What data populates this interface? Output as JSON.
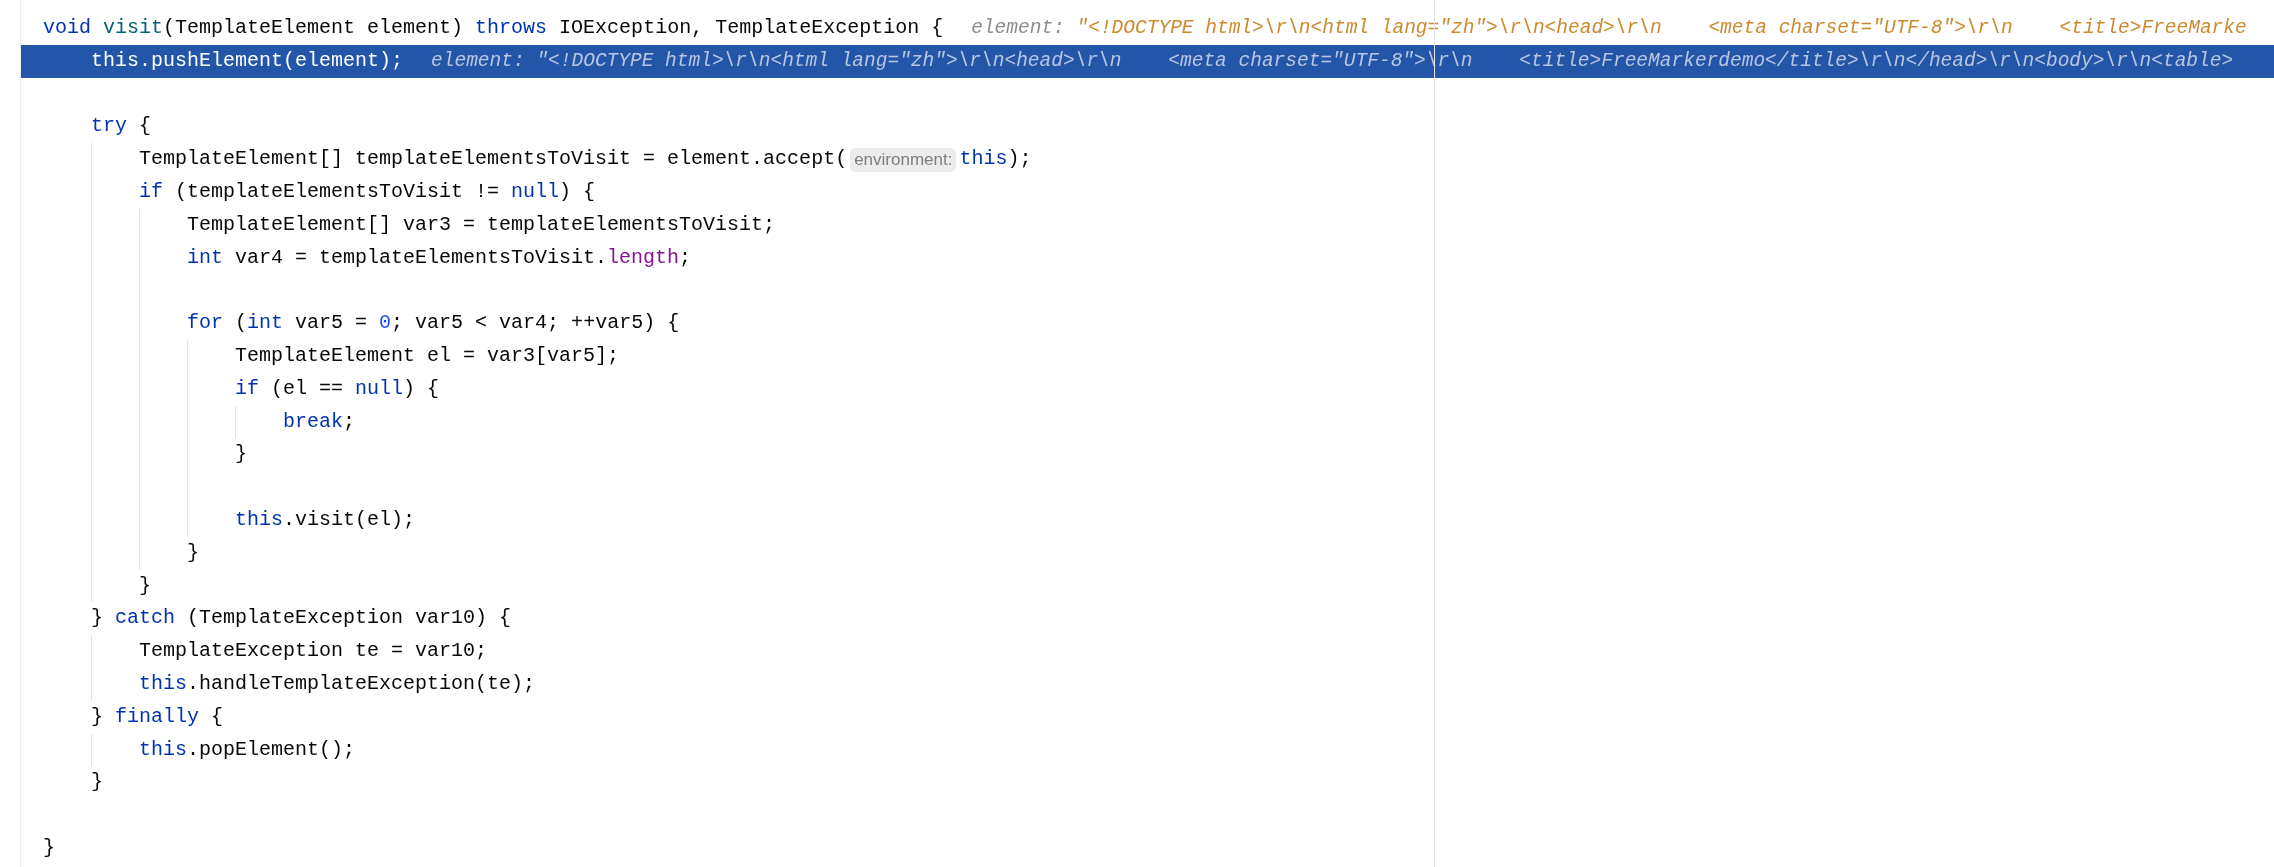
{
  "lines": [
    {
      "kind": "code",
      "selected": false,
      "segments": [
        {
          "kind": "code",
          "tokens": [
            {
              "kind": "keyword",
              "text": "void"
            },
            {
              "kind": "method",
              "text": " visit"
            },
            {
              "kind": "plain",
              "text": "(TemplateElement element) "
            },
            {
              "kind": "keyword",
              "text": "throws"
            },
            {
              "kind": "plain",
              "text": " IOException, TemplateException {"
            }
          ]
        },
        {
          "kind": "value_hint",
          "name": "element:",
          "value": "\"<!DOCTYPE html>\\r\\n<html lang=\"zh\">\\r\\n<head>\\r\\n    <meta charset=\"UTF-8\">\\r\\n    <title>FreeMarke"
        }
      ],
      "children": [
        {
          "kind": "code",
          "selected": true,
          "segments": [
            {
              "kind": "code",
              "tokens": [
                {
                  "kind": "keyword",
                  "text": "this"
                },
                {
                  "kind": "plain",
                  "text": ".pushElement(element);"
                }
              ]
            },
            {
              "kind": "value_hint",
              "name": "element:",
              "value": "\"<!DOCTYPE html>\\r\\n<html lang=\"zh\">\\r\\n<head>\\r\\n    <meta charset=\"UTF-8\">\\r\\n    <title>FreeMarkerdemo</title>\\r\\n</head>\\r\\n<body>\\r\\n<table>"
            }
          ]
        },
        {
          "kind": "blank"
        },
        {
          "kind": "code",
          "selected": false,
          "segments": [
            {
              "kind": "code",
              "tokens": [
                {
                  "kind": "keyword",
                  "text": "try"
                },
                {
                  "kind": "plain",
                  "text": " {"
                }
              ]
            }
          ],
          "children": [
            {
              "kind": "code",
              "selected": false,
              "segments": [
                {
                  "kind": "code",
                  "tokens": [
                    {
                      "kind": "plain",
                      "text": "TemplateElement[] templateElementsToVisit = element.accept("
                    }
                  ]
                },
                {
                  "kind": "param_hint",
                  "text": "environment:"
                },
                {
                  "kind": "code",
                  "tokens": [
                    {
                      "kind": "keyword",
                      "text": "this"
                    },
                    {
                      "kind": "plain",
                      "text": ");"
                    }
                  ]
                }
              ]
            },
            {
              "kind": "code",
              "selected": false,
              "segments": [
                {
                  "kind": "code",
                  "tokens": [
                    {
                      "kind": "keyword",
                      "text": "if"
                    },
                    {
                      "kind": "plain",
                      "text": " (templateElementsToVisit != "
                    },
                    {
                      "kind": "keyword",
                      "text": "null"
                    },
                    {
                      "kind": "plain",
                      "text": ") {"
                    }
                  ]
                }
              ],
              "children": [
                {
                  "kind": "code",
                  "selected": false,
                  "segments": [
                    {
                      "kind": "code",
                      "tokens": [
                        {
                          "kind": "plain",
                          "text": "TemplateElement[] var3 = templateElementsToVisit;"
                        }
                      ]
                    }
                  ]
                },
                {
                  "kind": "code",
                  "selected": false,
                  "segments": [
                    {
                      "kind": "code",
                      "tokens": [
                        {
                          "kind": "keyword",
                          "text": "int"
                        },
                        {
                          "kind": "plain",
                          "text": " var4 = templateElementsToVisit."
                        },
                        {
                          "kind": "field",
                          "text": "length"
                        },
                        {
                          "kind": "plain",
                          "text": ";"
                        }
                      ]
                    }
                  ]
                },
                {
                  "kind": "blank"
                },
                {
                  "kind": "code",
                  "selected": false,
                  "segments": [
                    {
                      "kind": "code",
                      "tokens": [
                        {
                          "kind": "keyword",
                          "text": "for"
                        },
                        {
                          "kind": "plain",
                          "text": " ("
                        },
                        {
                          "kind": "keyword",
                          "text": "int"
                        },
                        {
                          "kind": "plain",
                          "text": " var5 = "
                        },
                        {
                          "kind": "number",
                          "text": "0"
                        },
                        {
                          "kind": "plain",
                          "text": "; var5 < var4; ++var5) {"
                        }
                      ]
                    }
                  ],
                  "children": [
                    {
                      "kind": "code",
                      "selected": false,
                      "segments": [
                        {
                          "kind": "code",
                          "tokens": [
                            {
                              "kind": "plain",
                              "text": "TemplateElement el = var3[var5];"
                            }
                          ]
                        }
                      ]
                    },
                    {
                      "kind": "code",
                      "selected": false,
                      "segments": [
                        {
                          "kind": "code",
                          "tokens": [
                            {
                              "kind": "keyword",
                              "text": "if"
                            },
                            {
                              "kind": "plain",
                              "text": " (el == "
                            },
                            {
                              "kind": "keyword",
                              "text": "null"
                            },
                            {
                              "kind": "plain",
                              "text": ") {"
                            }
                          ]
                        }
                      ],
                      "children": [
                        {
                          "kind": "code",
                          "selected": false,
                          "segments": [
                            {
                              "kind": "code",
                              "tokens": [
                                {
                                  "kind": "keyword",
                                  "text": "break"
                                },
                                {
                                  "kind": "plain",
                                  "text": ";"
                                }
                              ]
                            }
                          ]
                        }
                      ]
                    },
                    {
                      "kind": "code",
                      "selected": false,
                      "segments": [
                        {
                          "kind": "code",
                          "tokens": [
                            {
                              "kind": "plain",
                              "text": "}"
                            }
                          ]
                        }
                      ]
                    },
                    {
                      "kind": "blank"
                    },
                    {
                      "kind": "code",
                      "selected": false,
                      "segments": [
                        {
                          "kind": "code",
                          "tokens": [
                            {
                              "kind": "keyword",
                              "text": "this"
                            },
                            {
                              "kind": "plain",
                              "text": ".visit(el);"
                            }
                          ]
                        }
                      ]
                    }
                  ]
                },
                {
                  "kind": "code",
                  "selected": false,
                  "segments": [
                    {
                      "kind": "code",
                      "tokens": [
                        {
                          "kind": "plain",
                          "text": "}"
                        }
                      ]
                    }
                  ]
                }
              ]
            },
            {
              "kind": "code",
              "selected": false,
              "segments": [
                {
                  "kind": "code",
                  "tokens": [
                    {
                      "kind": "plain",
                      "text": "}"
                    }
                  ]
                }
              ]
            }
          ]
        },
        {
          "kind": "code",
          "selected": false,
          "segments": [
            {
              "kind": "code",
              "tokens": [
                {
                  "kind": "plain",
                  "text": "} "
                },
                {
                  "kind": "keyword",
                  "text": "catch"
                },
                {
                  "kind": "plain",
                  "text": " (TemplateException var10) {"
                }
              ]
            }
          ],
          "children": [
            {
              "kind": "code",
              "selected": false,
              "segments": [
                {
                  "kind": "code",
                  "tokens": [
                    {
                      "kind": "plain",
                      "text": "TemplateException te = var10;"
                    }
                  ]
                }
              ]
            },
            {
              "kind": "code",
              "selected": false,
              "segments": [
                {
                  "kind": "code",
                  "tokens": [
                    {
                      "kind": "keyword",
                      "text": "this"
                    },
                    {
                      "kind": "plain",
                      "text": ".handleTemplateException(te);"
                    }
                  ]
                }
              ]
            }
          ]
        },
        {
          "kind": "code",
          "selected": false,
          "segments": [
            {
              "kind": "code",
              "tokens": [
                {
                  "kind": "plain",
                  "text": "} "
                },
                {
                  "kind": "keyword",
                  "text": "finally"
                },
                {
                  "kind": "plain",
                  "text": " {"
                }
              ]
            }
          ],
          "children": [
            {
              "kind": "code",
              "selected": false,
              "segments": [
                {
                  "kind": "code",
                  "tokens": [
                    {
                      "kind": "keyword",
                      "text": "this"
                    },
                    {
                      "kind": "plain",
                      "text": ".popElement();"
                    }
                  ]
                }
              ]
            }
          ]
        },
        {
          "kind": "code",
          "selected": false,
          "segments": [
            {
              "kind": "code",
              "tokens": [
                {
                  "kind": "plain",
                  "text": "}"
                }
              ]
            }
          ]
        },
        {
          "kind": "blank"
        }
      ]
    },
    {
      "kind": "code",
      "selected": false,
      "segments": [
        {
          "kind": "code",
          "tokens": [
            {
              "kind": "plain",
              "text": "}"
            }
          ]
        }
      ]
    }
  ]
}
